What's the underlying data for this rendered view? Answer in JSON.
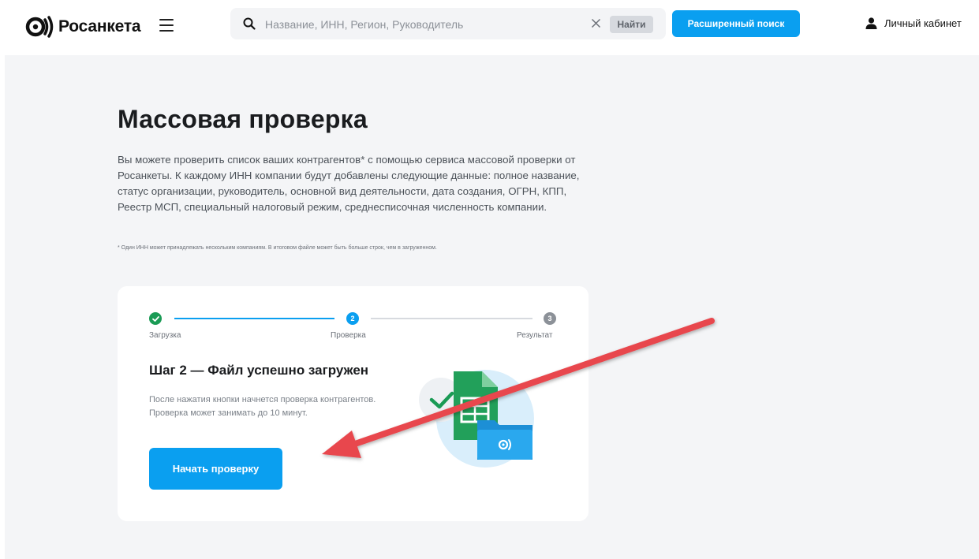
{
  "header": {
    "logo_text": "Росанкета",
    "search": {
      "placeholder": "Название, ИНН, Регион, Руководитель",
      "value": ""
    },
    "find_label": "Найти",
    "advanced_search_label": "Расширенный поиск",
    "cabinet_label": "Личный кабинет"
  },
  "page": {
    "title": "Массовая проверка",
    "description": "Вы можете проверить список ваших контрагентов* с помощью сервиса массовой проверки от Росанкеты. К каждому ИНН компании будут добавлены следующие данные: полное название, статус организации, руководитель, основной вид деятельности, дата создания, ОГРН, КПП, Реестр МСП, специальный налоговый режим, среднесписочная численность компании.",
    "footnote": "* Один ИНН может принадлежать нескольким компаниям. В итоговом файле может быть больше строк, чем в загруженном."
  },
  "stepper": {
    "steps": [
      {
        "label": "Загрузка",
        "state": "done"
      },
      {
        "label": "Проверка",
        "number": "2",
        "state": "active"
      },
      {
        "label": "Результат",
        "number": "3",
        "state": "pending"
      }
    ]
  },
  "card": {
    "title": "Шаг 2 — Файл успешно загружен",
    "text": "После нажатия кнопки начнется проверка контрагентов. Проверка может занимать до 10 минут.",
    "button_label": "Начать проверку"
  },
  "colors": {
    "accent": "#0a9ff0",
    "success": "#1a9b55",
    "pending": "#8c9198",
    "annotation_arrow": "#e8474d",
    "page_bg": "#f4f5f7"
  },
  "icons": [
    "logo-icon",
    "menu-icon",
    "search-icon",
    "close-icon",
    "user-icon",
    "check-icon",
    "spreadsheet-icon",
    "folder-icon"
  ]
}
